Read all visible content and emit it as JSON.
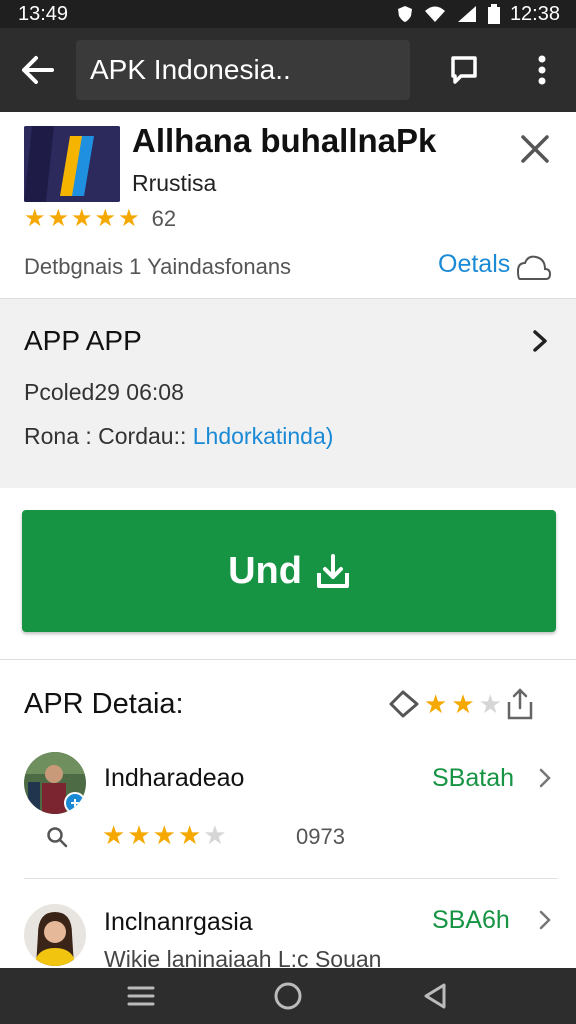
{
  "status_bar": {
    "time_left": "13:49",
    "time_right": "12:38"
  },
  "app_bar": {
    "search_text": "APK Indonesia.."
  },
  "app": {
    "title": "Allhana buhallnaPk",
    "developer": "Rrustisa",
    "rating_stars": 5,
    "rating_count": "62",
    "meta": "Detbgnais  1 Yaindasfonans",
    "details_link": "Oetals"
  },
  "info": {
    "title": "APP APP",
    "updated": "Pcoled29 06:08",
    "row_label": "Rona  :  Cordau::",
    "row_link": "Lhdorkatinda)"
  },
  "download_button": {
    "label": "Und"
  },
  "details": {
    "title": "APR Detaia:",
    "stars_filled": 2,
    "stars_total": 3
  },
  "reviews": [
    {
      "name": "Indharadeao",
      "action": "SBatah",
      "stars": 4,
      "stars_total": 5,
      "count": "0973",
      "sub": ""
    },
    {
      "name": "Inclnanrgasia",
      "action": "SBA6h",
      "sub": "Wikie laninaiaah L:c Souan"
    }
  ],
  "colors": {
    "accent_green": "#179443",
    "link_blue": "#1a8ad6",
    "star_gold": "#f5a900",
    "app_bar": "#2d2d2d"
  }
}
